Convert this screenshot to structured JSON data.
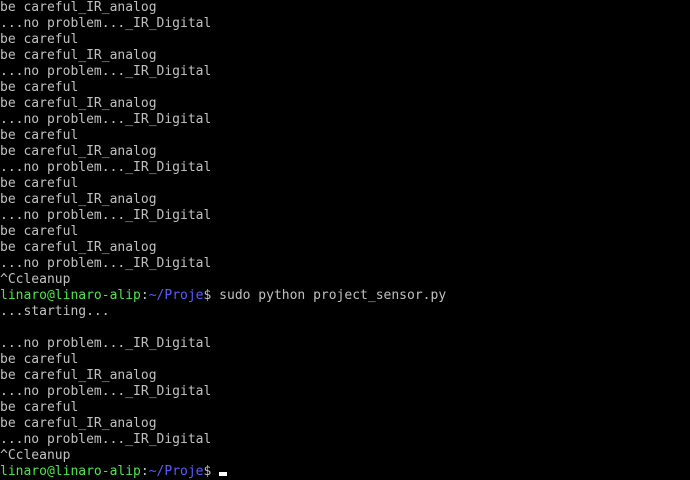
{
  "terminal": {
    "colors": {
      "background": "#000000",
      "text": "#c0c0c0",
      "prompt_user": "#4ee44e",
      "prompt_path": "#5c5cff",
      "cursor": "#ffffff"
    },
    "prompt": {
      "user_host": "linaro@linaro-alip",
      "colon": ":",
      "path": "~/Proje",
      "dollar": "$"
    },
    "lines_block_1": [
      "be careful_IR_analog",
      "...no problem..._IR_Digital",
      "be careful",
      "be careful_IR_analog",
      "...no problem..._IR_Digital",
      "be careful",
      "be careful_IR_analog",
      "...no problem..._IR_Digital",
      "be careful",
      "be careful_IR_analog",
      "...no problem..._IR_Digital",
      "be careful",
      "be careful_IR_analog",
      "...no problem..._IR_Digital",
      "be careful",
      "be careful_IR_analog",
      "...no problem..._IR_Digital",
      "^Ccleanup"
    ],
    "command_line": {
      "command": " sudo python project_sensor.py"
    },
    "lines_block_2": [
      "...starting...",
      "",
      "...no problem..._IR_Digital",
      "be careful",
      "be careful_IR_analog",
      "...no problem..._IR_Digital",
      "be careful",
      "be careful_IR_analog",
      "...no problem..._IR_Digital",
      "^Ccleanup"
    ],
    "final_prompt": {
      "command": " "
    }
  }
}
